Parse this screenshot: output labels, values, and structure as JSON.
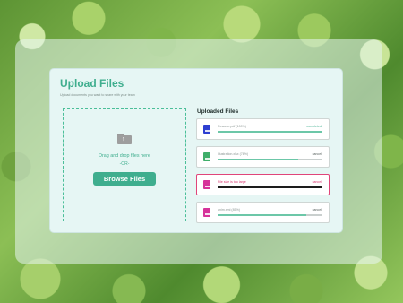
{
  "page": {
    "title": "Upload Files",
    "subtitle": "Upload documents you want to share with your team"
  },
  "dropzone": {
    "icon": "folder-upload-icon",
    "instruction": "Drag and drop files here",
    "separator": "-OR-",
    "browse_label": "Browse Files"
  },
  "uploaded": {
    "heading": "Uploaded Files",
    "files": [
      {
        "name": "Resume.pdf (100%)",
        "status": "completed",
        "progress": 1.0,
        "icon_color": "#2e3fd1",
        "state": "completed"
      },
      {
        "name": "Illustration.xlsx (78%)",
        "status": "cancel",
        "progress": 0.78,
        "icon_color": "#3fae6a",
        "state": "uploading"
      },
      {
        "name": "File size is too large",
        "status": "cancel",
        "progress": 0.0,
        "icon_color": "#d6339a",
        "state": "error"
      },
      {
        "name": "anim.xml (85%)",
        "status": "cancel",
        "progress": 0.85,
        "icon_color": "#d6339a",
        "state": "uploading"
      }
    ]
  },
  "colors": {
    "accent": "#3fae8e",
    "error": "#e0457a"
  }
}
